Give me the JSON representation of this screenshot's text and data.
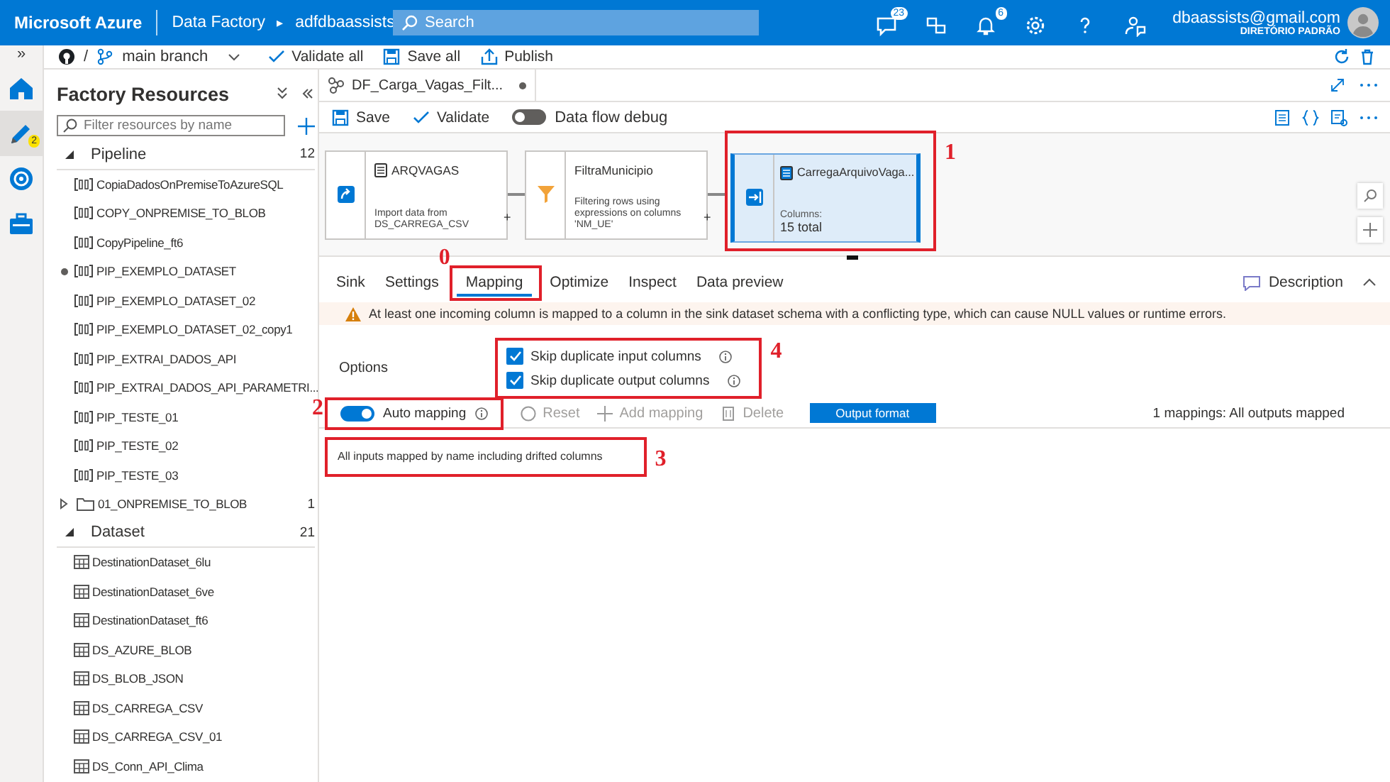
{
  "topbar": {
    "brand": "Microsoft Azure",
    "service": "Data Factory",
    "separator": "▸",
    "factory": "adfdbaassists",
    "search": {
      "placeholder": "Search"
    },
    "icons": [
      {
        "kind": "feedback",
        "badge": "23"
      },
      {
        "kind": "directory"
      },
      {
        "kind": "bell",
        "badge": "6"
      },
      {
        "kind": "settings"
      },
      {
        "kind": "help"
      },
      {
        "kind": "person"
      }
    ],
    "account": {
      "email": "dbaassists@gmail.com",
      "directory": "DIRETÓRIO PADRÃO"
    }
  },
  "rail": {
    "expand": "»",
    "items": [
      {
        "kind": "home",
        "selected": false
      },
      {
        "kind": "author",
        "selected": true,
        "badge": "2"
      },
      {
        "kind": "monitor",
        "selected": false
      },
      {
        "kind": "manage",
        "selected": false
      }
    ]
  },
  "toolbar": {
    "separator": "/",
    "branch": "main branch",
    "actions": [
      {
        "kind": "validate",
        "label": "Validate all"
      },
      {
        "kind": "save",
        "label": "Save all"
      },
      {
        "kind": "publish",
        "label": "Publish"
      }
    ]
  },
  "sidebar": {
    "title": "Factory Resources",
    "filter": {
      "placeholder": "Filter resources by name"
    },
    "sections": [
      {
        "label": "Pipeline",
        "count": "12",
        "expanded": true,
        "items": [
          {
            "kind": "pipeline",
            "label": "CopiaDadosOnPremiseToAzureSQL",
            "modified": false
          },
          {
            "kind": "pipeline",
            "label": "COPY_ONPREMISE_TO_BLOB",
            "modified": false
          },
          {
            "kind": "pipeline",
            "label": "CopyPipeline_ft6",
            "modified": false
          },
          {
            "kind": "pipeline",
            "label": "PIP_EXEMPLO_DATASET",
            "modified": true
          },
          {
            "kind": "pipeline",
            "label": "PIP_EXEMPLO_DATASET_02",
            "modified": false
          },
          {
            "kind": "pipeline",
            "label": "PIP_EXEMPLO_DATASET_02_copy1",
            "modified": false
          },
          {
            "kind": "pipeline",
            "label": "PIP_EXTRAI_DADOS_API",
            "modified": false
          },
          {
            "kind": "pipeline",
            "label": "PIP_EXTRAI_DADOS_API_PARAMETRI...",
            "modified": false
          },
          {
            "kind": "pipeline",
            "label": "PIP_TESTE_01",
            "modified": false
          },
          {
            "kind": "pipeline",
            "label": "PIP_TESTE_02",
            "modified": false
          },
          {
            "kind": "pipeline",
            "label": "PIP_TESTE_03",
            "modified": false
          },
          {
            "kind": "folder",
            "label": "01_ONPREMISE_TO_BLOB",
            "count": "1",
            "expanded": false
          }
        ]
      },
      {
        "label": "Dataset",
        "count": "21",
        "expanded": true,
        "items": [
          {
            "kind": "dataset",
            "label": "DestinationDataset_6lu"
          },
          {
            "kind": "dataset",
            "label": "DestinationDataset_6ve"
          },
          {
            "kind": "dataset",
            "label": "DestinationDataset_ft6"
          },
          {
            "kind": "dataset",
            "label": "DS_AZURE_BLOB"
          },
          {
            "kind": "dataset",
            "label": "DS_BLOB_JSON"
          },
          {
            "kind": "dataset",
            "label": "DS_CARREGA_CSV"
          },
          {
            "kind": "dataset",
            "label": "DS_CARREGA_CSV_01"
          },
          {
            "kind": "dataset",
            "label": "DS_Conn_API_Clima"
          }
        ]
      }
    ]
  },
  "editor": {
    "tab": {
      "title": "DF_Carga_Vagas_Filt...",
      "unsaved": true
    },
    "actions": [
      {
        "kind": "save",
        "label": "Save"
      },
      {
        "kind": "validate",
        "label": "Validate"
      }
    ],
    "debug": {
      "label": "Data flow debug",
      "on": false
    },
    "nodes": [
      {
        "kind": "source",
        "title": "ARQVAGAS",
        "description": "Import data from DS_CARREGA_CSV",
        "selected": false,
        "add": "+"
      },
      {
        "kind": "filter",
        "title": "FiltraMunicipio",
        "description": "Filtering rows using expressions on columns 'NM_UE'",
        "selected": false,
        "add": "+"
      },
      {
        "kind": "sink",
        "title": "CarregaArquivoVaga...",
        "caption": "Columns:",
        "description": "15 total",
        "selected": true,
        "callout": {
          "label": "1"
        }
      }
    ],
    "panel": {
      "tabs": [
        {
          "label": "Sink",
          "selected": false
        },
        {
          "label": "Settings",
          "selected": false
        },
        {
          "label": "Mapping",
          "selected": true,
          "callout": {
            "label": "0"
          }
        },
        {
          "label": "Optimize",
          "selected": false
        },
        {
          "label": "Inspect",
          "selected": false
        },
        {
          "label": "Data preview",
          "selected": false
        }
      ],
      "description": "Description",
      "warning": "At least one incoming column is mapped to a column in the sink dataset schema with a conflicting type, which can cause NULL values or runtime errors.",
      "options_label": "Options",
      "options": [
        {
          "label": "Skip duplicate input columns",
          "checked": true
        },
        {
          "label": "Skip duplicate output columns",
          "checked": true
        }
      ],
      "options_callout": {
        "label": "4"
      },
      "auto_mapping": {
        "label": "Auto mapping",
        "on": true,
        "callout": {
          "label": "2"
        }
      },
      "actions": [
        {
          "kind": "reset",
          "label": "Reset",
          "disabled": true
        },
        {
          "kind": "add",
          "label": "Add mapping",
          "disabled": true
        },
        {
          "kind": "delete",
          "label": "Delete",
          "disabled": true
        }
      ],
      "output_format": "Output format",
      "summary": "1 mappings: All outputs mapped",
      "info": {
        "text": "All inputs mapped by name including drifted columns",
        "callout": {
          "label": "3"
        }
      }
    }
  }
}
